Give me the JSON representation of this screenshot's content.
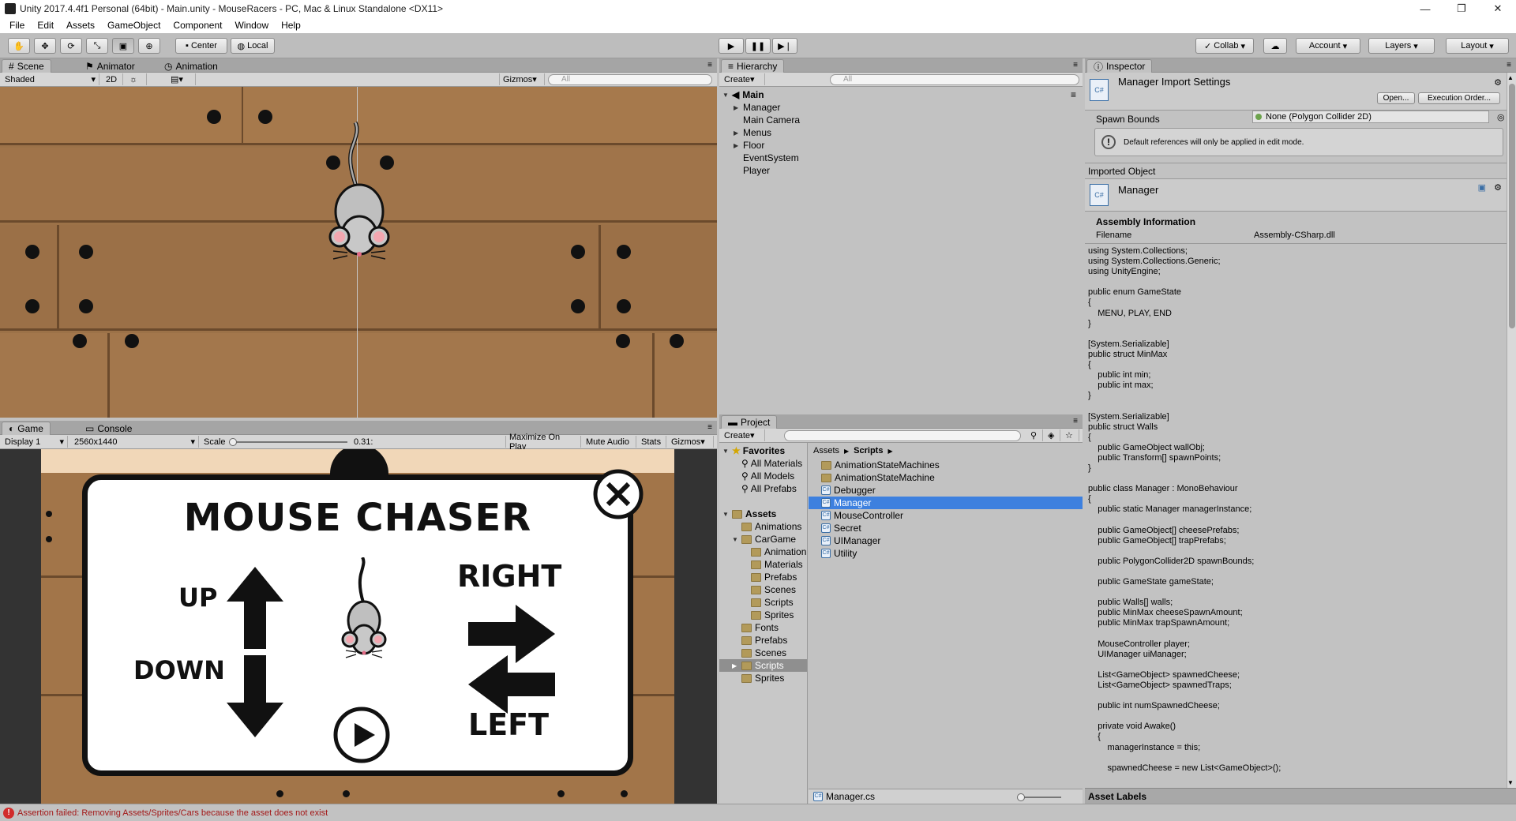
{
  "titlebar": {
    "title": "Unity 2017.4.4f1 Personal (64bit) - Main.unity - MouseRacers - PC, Mac & Linux Standalone <DX11>"
  },
  "menu": [
    "File",
    "Edit",
    "Assets",
    "GameObject",
    "Component",
    "Window",
    "Help"
  ],
  "toolbar": {
    "center": "Center",
    "local": "Local",
    "collab": "Collab",
    "account": "Account",
    "layers": "Layers",
    "layout": "Layout"
  },
  "scene": {
    "tabs": [
      "Scene",
      "Animator",
      "Animation"
    ],
    "shading": "Shaded",
    "mode2d": "2D",
    "gizmos": "Gizmos",
    "search_placeholder": "All"
  },
  "game": {
    "tabs": [
      "Game",
      "Console"
    ],
    "display": "Display 1",
    "resolution": "2560x1440",
    "scale_label": "Scale",
    "scale_value": "0.31:",
    "maximize": "Maximize On Play",
    "mute": "Mute Audio",
    "stats": "Stats",
    "gizmos": "Gizmos",
    "overlay": {
      "title": "MOUSE CHASER",
      "up": "UP",
      "down": "DOWN",
      "right": "RIGHT",
      "left": "LEFT"
    }
  },
  "hierarchy": {
    "tab": "Hierarchy",
    "create": "Create",
    "search_placeholder": "All",
    "scene": "Main",
    "items": [
      "Manager",
      "Main Camera",
      "Menus",
      "Floor",
      "EventSystem",
      "Player"
    ]
  },
  "project": {
    "tab": "Project",
    "create": "Create",
    "favorites": {
      "label": "Favorites",
      "items": [
        "All Materials",
        "All Models",
        "All Prefabs"
      ]
    },
    "assets": {
      "label": "Assets",
      "items": [
        "Animations",
        "CarGame",
        "Animation",
        "Materials",
        "Prefabs",
        "Scenes",
        "Scripts",
        "Sprites",
        "Fonts",
        "Prefabs",
        "Scenes",
        "Scripts",
        "Sprites"
      ]
    },
    "breadcrumb": [
      "Assets",
      "Scripts"
    ],
    "files": [
      "AnimationStateMachines",
      "AnimationStateMachine",
      "Debugger",
      "Manager",
      "MouseController",
      "Secret",
      "UIManager",
      "Utility"
    ],
    "selected_file": "Manager",
    "footer": "Manager.cs"
  },
  "inspector": {
    "tab": "Inspector",
    "title": "Manager Import Settings",
    "open": "Open...",
    "exec_order": "Execution Order...",
    "spawn_bounds_label": "Spawn Bounds",
    "spawn_bounds_value": "None (Polygon Collider 2D)",
    "info_msg": "Default references will only be applied in edit mode.",
    "imported_object": "Imported Object",
    "object_name": "Manager",
    "assembly_title": "Assembly Information",
    "filename_label": "Filename",
    "filename_value": "Assembly-CSharp.dll",
    "code": "using System.Collections;\nusing System.Collections.Generic;\nusing UnityEngine;\n\npublic enum GameState\n{\n    MENU, PLAY, END\n}\n\n[System.Serializable]\npublic struct MinMax\n{\n    public int min;\n    public int max;\n}\n\n[System.Serializable]\npublic struct Walls\n{\n    public GameObject wallObj;\n    public Transform[] spawnPoints;\n}\n\npublic class Manager : MonoBehaviour\n{\n    public static Manager managerInstance;\n\n    public GameObject[] cheesePrefabs;\n    public GameObject[] trapPrefabs;\n\n    public PolygonCollider2D spawnBounds;\n\n    public GameState gameState;\n\n    public Walls[] walls;\n    public MinMax cheeseSpawnAmount;\n    public MinMax trapSpawnAmount;\n\n    MouseController player;\n    UIManager uiManager;\n\n    List<GameObject> spawnedCheese;\n    List<GameObject> spawnedTraps;\n\n    public int numSpawnedCheese;\n\n    private void Awake()\n    {\n        managerInstance = this;\n\n        spawnedCheese = new List<GameObject>();",
    "asset_labels": "Asset Labels"
  },
  "status": {
    "message": "Assertion failed: Removing Assets/Sprites/Cars because the asset does not exist"
  }
}
